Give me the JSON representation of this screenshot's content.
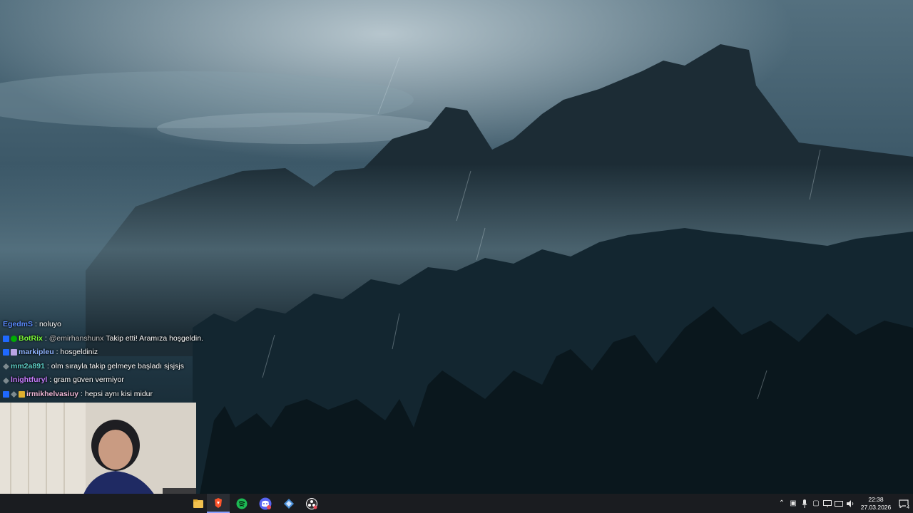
{
  "chat": {
    "messages": [
      {
        "user": "EgedmS",
        "user_color": "#5b8cff",
        "text": "noluyo",
        "mention": "",
        "badges": []
      },
      {
        "user": "BotRix",
        "user_color": "#7cfc3a",
        "text": "Takip etti! Aramıza hoşgeldin.",
        "mention": "@emirhanshunx",
        "badges": [
          "mod",
          "verified"
        ]
      },
      {
        "user": "markipleu",
        "user_color": "#8fb4ff",
        "text": "hosgeldiniz",
        "mention": "",
        "badges": [
          "mod",
          "sub"
        ]
      },
      {
        "user": "mm2a891",
        "user_color": "#5fd0c8",
        "text": "olm sırayla takip gelmeye başladı sjsjsjs",
        "mention": "",
        "badges": [
          "sword"
        ]
      },
      {
        "user": "lnightfuryl",
        "user_color": "#c77dff",
        "text": "gram güven vermiyor",
        "mention": "",
        "badges": [
          "sword"
        ]
      },
      {
        "user": "irmikhelvasiuy",
        "user_color": "#f0b8d8",
        "text": "hepsi aynı kisi midur",
        "mention": "",
        "badges": [
          "mod",
          "sword",
          "gold"
        ]
      }
    ]
  },
  "taskbar": {
    "apps": [
      {
        "name": "file-explorer-icon",
        "color": "#f2c14e"
      },
      {
        "name": "brave-browser-icon",
        "color": "#fb542b"
      },
      {
        "name": "spotify-icon",
        "color": "#1db954"
      },
      {
        "name": "discord-icon",
        "color": "#5865f2"
      },
      {
        "name": "streaming-app-icon",
        "color": "#4a8fd8"
      },
      {
        "name": "obs-studio-icon",
        "color": "#ffffff"
      }
    ],
    "tray": {
      "time": "22:38",
      "date": "27.03.2026",
      "notification_count": "4"
    }
  }
}
